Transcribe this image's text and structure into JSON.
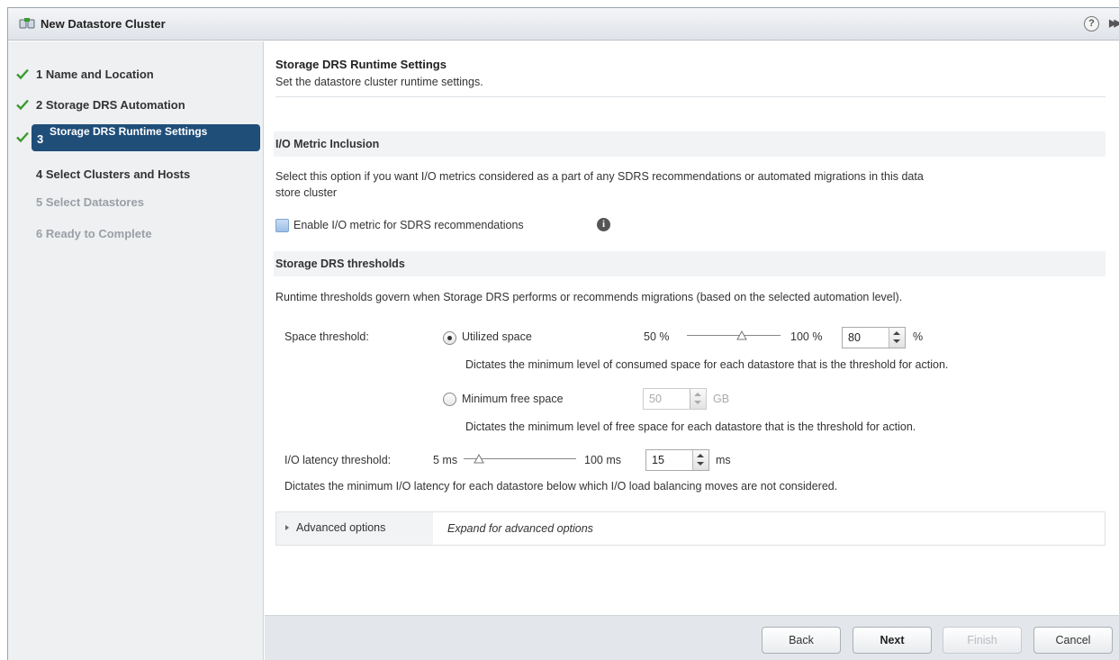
{
  "window": {
    "title": "New Datastore Cluster",
    "help": "?"
  },
  "steps": [
    {
      "num": "1",
      "label": "1 Name and Location",
      "state": "done"
    },
    {
      "num": "2",
      "label": "2 Storage DRS Automation",
      "state": "done"
    },
    {
      "num": "3",
      "label": "Storage DRS Runtime Settings",
      "state": "current"
    },
    {
      "num": "4",
      "label": "4 Select Clusters and Hosts",
      "state": "enabled"
    },
    {
      "num": "5",
      "label": "5 Select Datastores",
      "state": "disabled"
    },
    {
      "num": "6",
      "label": "6 Ready to Complete",
      "state": "disabled"
    }
  ],
  "page": {
    "title": "Storage DRS Runtime Settings",
    "subtitle": "Set the datastore cluster runtime settings."
  },
  "io_metric": {
    "heading": "I/O Metric Inclusion",
    "description_line1": "Select this option if you want I/O metrics considered as a part of any SDRS recommendations or automated migrations in this data",
    "description_line2": "store cluster",
    "checkbox_label": "Enable I/O metric for SDRS recommendations",
    "checked": false
  },
  "thresholds": {
    "heading": "Storage DRS thresholds",
    "description": "Runtime thresholds govern when Storage DRS performs or recommends migrations (based on the selected automation level).",
    "space_label": "Space threshold:",
    "utilized": {
      "label": "Utilized space",
      "selected": true,
      "min_label": "50 %",
      "max_label": "100 %",
      "value": "80",
      "unit": "%",
      "slider_fraction": 0.6,
      "help": "Dictates the minimum level of consumed space for each datastore that is the threshold for action."
    },
    "free": {
      "label": "Minimum free space",
      "selected": false,
      "value": "50",
      "unit": "GB",
      "help": "Dictates the minimum level of free space for each datastore that is the threshold for action."
    },
    "latency": {
      "label": "I/O latency threshold:",
      "min_label": "5 ms",
      "max_label": "100 ms",
      "value": "15",
      "unit": "ms",
      "slider_fraction": 0.1,
      "help": "Dictates the minimum I/O latency for each datastore below which I/O load balancing moves are not considered."
    }
  },
  "advanced": {
    "label": "Advanced options",
    "description": "Expand for advanced options"
  },
  "footer": {
    "back": "Back",
    "next": "Next",
    "finish": "Finish",
    "cancel": "Cancel"
  },
  "colors": {
    "accent": "#1f4e79",
    "check": "#3a9a2e"
  }
}
